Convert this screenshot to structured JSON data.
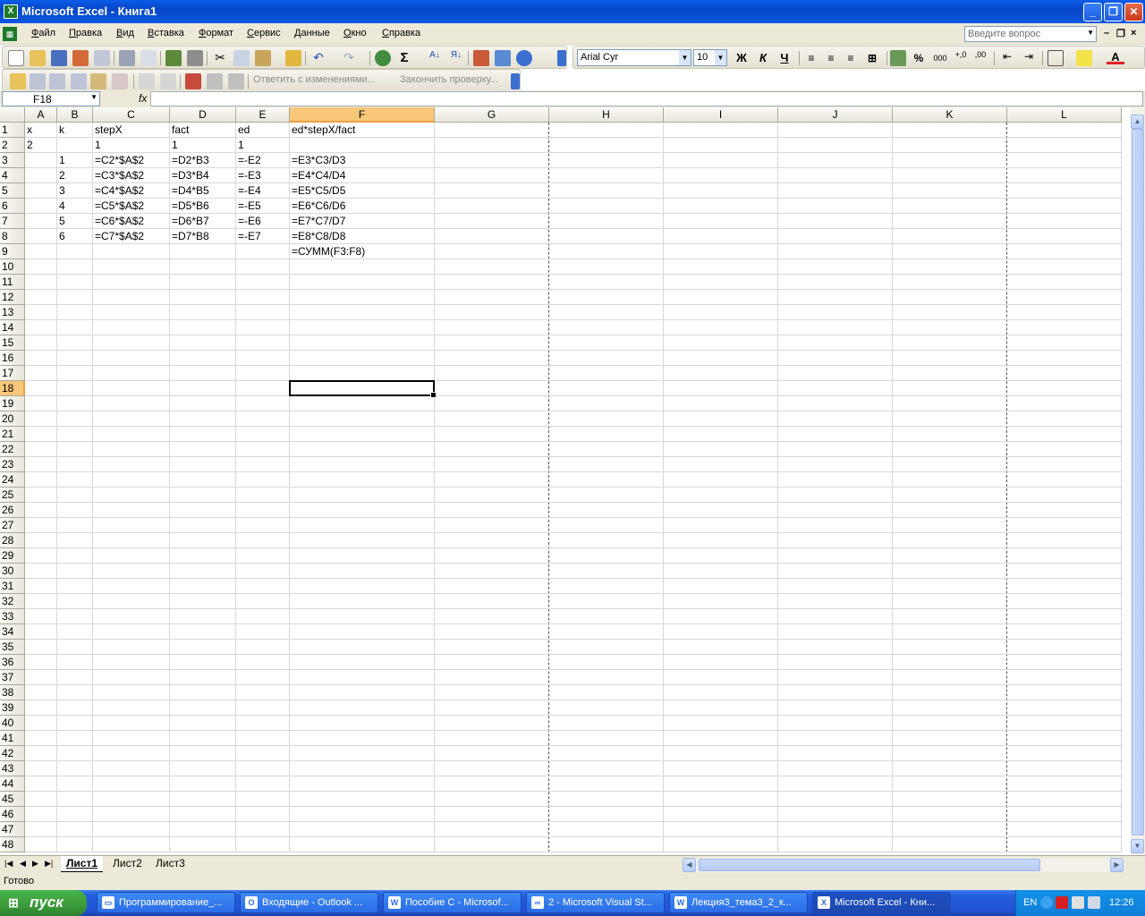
{
  "window": {
    "title": "Microsoft Excel - Книга1",
    "app_icon": "X"
  },
  "menu": {
    "items": [
      "Файл",
      "Правка",
      "Вид",
      "Вставка",
      "Формат",
      "Сервис",
      "Данные",
      "Окно",
      "Справка"
    ],
    "ask_placeholder": "Введите вопрос"
  },
  "format_toolbar": {
    "font_name": "Arial Cyr",
    "font_size": "10",
    "bold": "Ж",
    "italic": "К",
    "underline": "Ч",
    "percent": "%",
    "thousands": "000"
  },
  "review_toolbar": {
    "reply_label": "Ответить с изменениями...",
    "end_review_label": "Закончить проверку..."
  },
  "formula_bar": {
    "name_box": "F18",
    "fx_label": "fx",
    "formula": ""
  },
  "columns": [
    "A",
    "B",
    "C",
    "D",
    "E",
    "F",
    "G",
    "H",
    "I",
    "J",
    "K",
    "L"
  ],
  "selected_column": "F",
  "selected_row": 18,
  "row_count": 48,
  "cells": [
    {
      "ref": "A1",
      "value": "x"
    },
    {
      "ref": "B1",
      "value": "k"
    },
    {
      "ref": "C1",
      "value": "stepX"
    },
    {
      "ref": "D1",
      "value": "fact"
    },
    {
      "ref": "E1",
      "value": "ed"
    },
    {
      "ref": "F1",
      "value": "ed*stepX/fact"
    },
    {
      "ref": "A2",
      "value": "2"
    },
    {
      "ref": "C2",
      "value": "1"
    },
    {
      "ref": "D2",
      "value": "1"
    },
    {
      "ref": "E2",
      "value": "1"
    },
    {
      "ref": "B3",
      "value": "1"
    },
    {
      "ref": "C3",
      "value": "=C2*$A$2"
    },
    {
      "ref": "D3",
      "value": "=D2*B3"
    },
    {
      "ref": "E3",
      "value": "=-E2"
    },
    {
      "ref": "F3",
      "value": "=E3*C3/D3"
    },
    {
      "ref": "B4",
      "value": "2"
    },
    {
      "ref": "C4",
      "value": "=C3*$A$2"
    },
    {
      "ref": "D4",
      "value": "=D3*B4"
    },
    {
      "ref": "E4",
      "value": "=-E3"
    },
    {
      "ref": "F4",
      "value": "=E4*C4/D4"
    },
    {
      "ref": "B5",
      "value": "3"
    },
    {
      "ref": "C5",
      "value": "=C4*$A$2"
    },
    {
      "ref": "D5",
      "value": "=D4*B5"
    },
    {
      "ref": "E5",
      "value": "=-E4"
    },
    {
      "ref": "F5",
      "value": "=E5*C5/D5"
    },
    {
      "ref": "B6",
      "value": "4"
    },
    {
      "ref": "C6",
      "value": "=C5*$A$2"
    },
    {
      "ref": "D6",
      "value": "=D5*B6"
    },
    {
      "ref": "E6",
      "value": "=-E5"
    },
    {
      "ref": "F6",
      "value": "=E6*C6/D6"
    },
    {
      "ref": "B7",
      "value": "5"
    },
    {
      "ref": "C7",
      "value": "=C6*$A$2"
    },
    {
      "ref": "D7",
      "value": "=D6*B7"
    },
    {
      "ref": "E7",
      "value": "=-E6"
    },
    {
      "ref": "F7",
      "value": "=E7*C7/D7"
    },
    {
      "ref": "B8",
      "value": "6"
    },
    {
      "ref": "C8",
      "value": "=C7*$A$2"
    },
    {
      "ref": "D8",
      "value": "=D7*B8"
    },
    {
      "ref": "E8",
      "value": "=-E7"
    },
    {
      "ref": "F8",
      "value": "=E8*C8/D8"
    },
    {
      "ref": "F9",
      "value": "=СУММ(F3:F8)"
    }
  ],
  "sheet_tabs": [
    "Лист1",
    "Лист2",
    "Лист3"
  ],
  "active_sheet": "Лист1",
  "status": "Готово",
  "taskbar": {
    "start_label": "пуск",
    "tasks": [
      {
        "label": "Программирование_...",
        "icon": "folder-icon"
      },
      {
        "label": "Входящие - Outlook ...",
        "icon": "outlook-icon"
      },
      {
        "label": "Пособие С - Microsof...",
        "icon": "word-icon"
      },
      {
        "label": "2 - Microsoft Visual St...",
        "icon": "visual-studio-icon"
      },
      {
        "label": "Лекция3_тема3_2_к...",
        "icon": "word-icon"
      },
      {
        "label": "Microsoft Excel - Кни...",
        "icon": "excel-icon"
      }
    ],
    "active_task": 5,
    "lang": "EN",
    "clock": "12:26"
  },
  "colors": {
    "selection_header": "#f8c77a",
    "titlebar": "#0a5ce8",
    "taskbar": "#245edb",
    "start_button": "#3a9b3a"
  }
}
